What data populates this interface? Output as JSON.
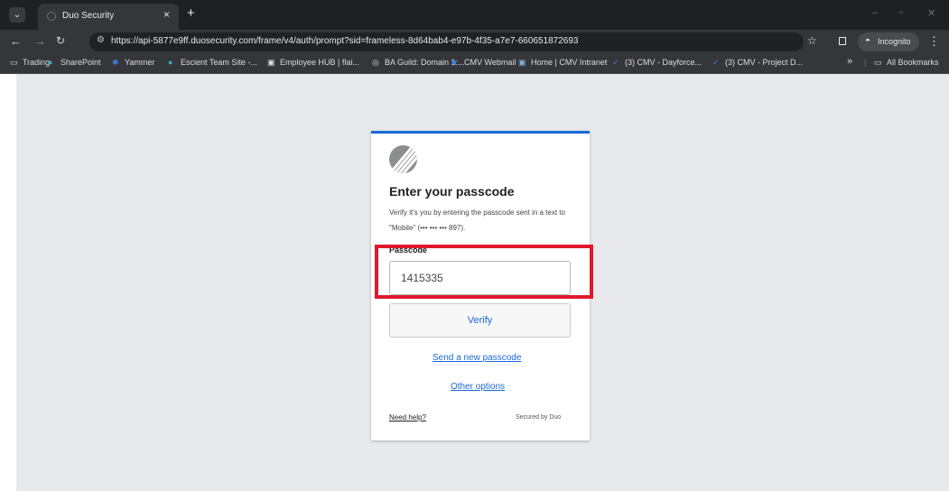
{
  "browser": {
    "tab_title": "Duo Security",
    "tab_close": "×",
    "new_tab": "+",
    "url": "https://api-5877e9ff.duosecurity.com/frame/v4/auth/prompt?sid=frameless-8d64bab4-e97b-4f35-a7e7-660651872693",
    "incognito_label": "Incognito",
    "window_controls": [
      "–",
      "▫",
      "✕"
    ],
    "bookmarks": [
      {
        "label": "Trading",
        "icon": "folder-icon"
      },
      {
        "label": "SharePoint",
        "icon": "sharepoint-icon"
      },
      {
        "label": "Yammer",
        "icon": "yammer-icon"
      },
      {
        "label": "Escient Team Site -...",
        "icon": "sharepoint-icon"
      },
      {
        "label": "Employee HUB | flai...",
        "icon": "image-icon"
      },
      {
        "label": "BA Guild: Domain 1:...",
        "icon": "globe-icon"
      },
      {
        "label": "CMV Webmail",
        "icon": "mail-icon"
      },
      {
        "label": "Home | CMV Intranet",
        "icon": "intranet-icon"
      },
      {
        "label": "(3) CMV - Dayforce...",
        "icon": "check-icon"
      },
      {
        "label": "(3) CMV - Project D...",
        "icon": "check-icon"
      }
    ],
    "bookmarks_overflow": "»",
    "all_bookmarks": "All Bookmarks"
  },
  "duo": {
    "heading": "Enter your passcode",
    "description": "Verify it's you by entering the passcode sent in a text to \"Mobile\" (••• ••• ••• 897).",
    "passcode_label": "Passcode",
    "passcode_value": "1415335",
    "verify_label": "Verify",
    "send_new_label": "Send a new passcode",
    "other_options_label": "Other options",
    "need_help_label": "Need help?",
    "secured_by": "Secured by Duo"
  },
  "colors": {
    "accent": "#1a69d6",
    "highlight": "#e0182d",
    "page_bg": "#e8e9ec"
  }
}
